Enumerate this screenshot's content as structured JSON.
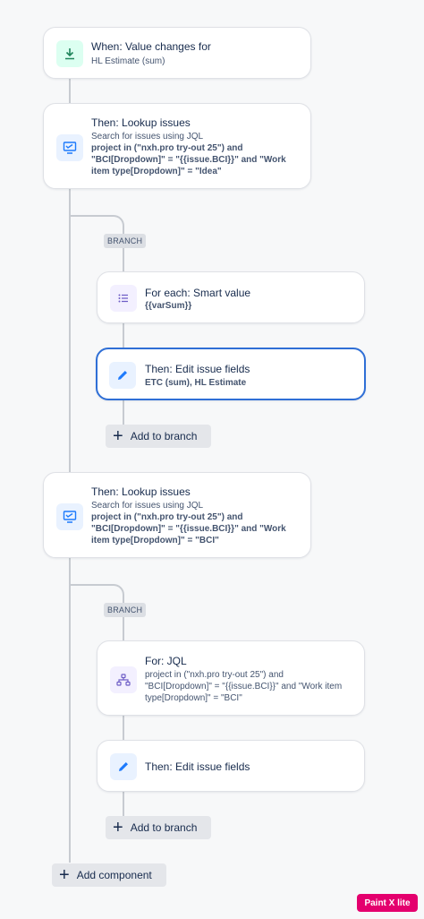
{
  "nodes": {
    "trigger": {
      "title": "When: Value changes for",
      "sub": "HL Estimate (sum)"
    },
    "lookup1": {
      "title": "Then: Lookup issues",
      "sub": "Search for issues using JQL",
      "jql": [
        "project in (\"nxh.pro try-out 25\") and",
        "\"BCI[Dropdown]\" = \"{{issue.BCI}}\" and \"Work",
        "item type[Dropdown]\" = \"Idea\""
      ]
    },
    "branch1_tag": "BRANCH",
    "foreach": {
      "title": "For each: Smart value",
      "sub": "{{varSum}}"
    },
    "edit1": {
      "title": "Then: Edit issue fields",
      "sub": "ETC (sum), HL Estimate"
    },
    "add_branch_1": "Add to branch",
    "lookup2": {
      "title": "Then: Lookup issues",
      "sub": "Search for issues using JQL",
      "jql": [
        "project in (\"nxh.pro try-out 25\") and",
        "\"BCI[Dropdown]\" = \"{{issue.BCI}}\" and \"Work",
        "item type[Dropdown]\" = \"BCI\""
      ]
    },
    "branch2_tag": "BRANCH",
    "forjql": {
      "title": "For: JQL",
      "lines": [
        "project in (\"nxh.pro try-out 25\") and",
        "\"BCI[Dropdown]\" = \"{{issue.BCI}}\" and \"Work item",
        "type[Dropdown]\" = \"BCI\""
      ]
    },
    "edit2": {
      "title": "Then: Edit issue fields"
    },
    "add_branch_2": "Add to branch",
    "add_component": "Add component"
  },
  "watermark": "Paint X lite",
  "colors": {
    "accent": "#2f6fd6",
    "badge": "#e4006e",
    "connector": "#c7cbd1"
  }
}
